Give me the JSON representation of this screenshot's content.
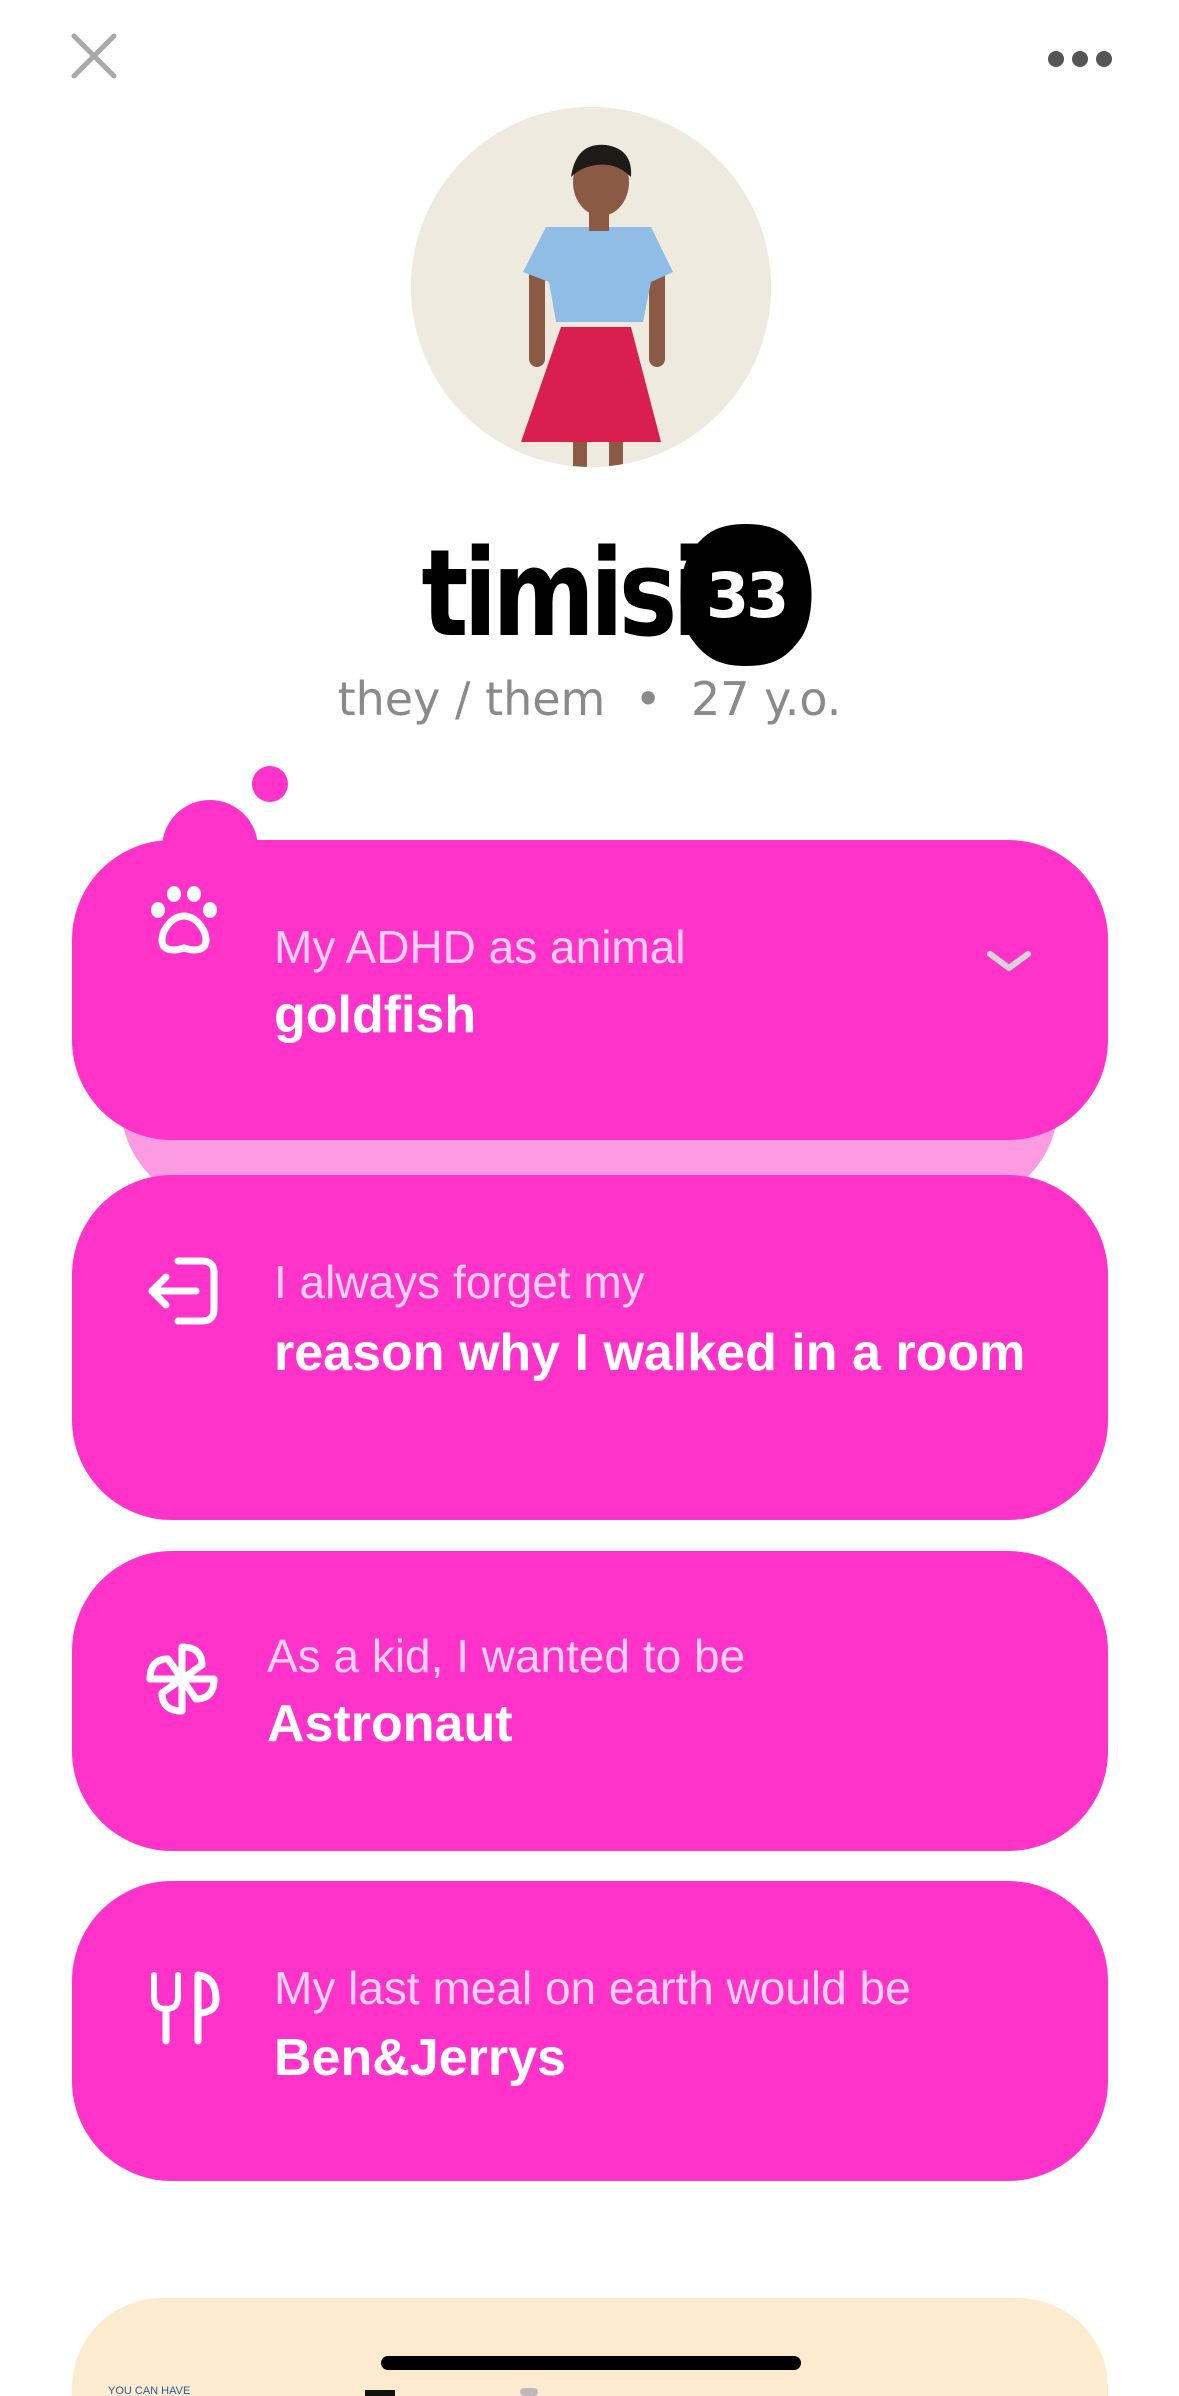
{
  "header": {
    "close_icon": "close-icon",
    "more_icon": "more-horizontal-icon"
  },
  "profile": {
    "name": "timisi",
    "score": "33",
    "meta": "they / them  •  27 y.o.",
    "photo": "profile-photo"
  },
  "colors": {
    "card_bg": "#ff33c9",
    "card_shadow": "#fd9be2",
    "card_label": "#ffd0f1",
    "card_value": "#ffffff",
    "meta_text": "#8a8a8a",
    "peek_bg": "#fdebd0"
  },
  "cards": [
    {
      "icon": "paw-icon",
      "label": "My ADHD as animal",
      "value": "goldfish",
      "expandable": true
    },
    {
      "icon": "exit-icon",
      "label": "I always forget my",
      "value": "reason why I walked in a room"
    },
    {
      "icon": "pinwheel-icon",
      "label": "As a kid, I wanted to be",
      "value": "Astronaut"
    },
    {
      "icon": "fork-knife-icon",
      "label": "My last meal on earth would be",
      "value": "Ben&Jerrys"
    }
  ],
  "peek": {
    "badge_text": "YOU CAN HAVE"
  }
}
